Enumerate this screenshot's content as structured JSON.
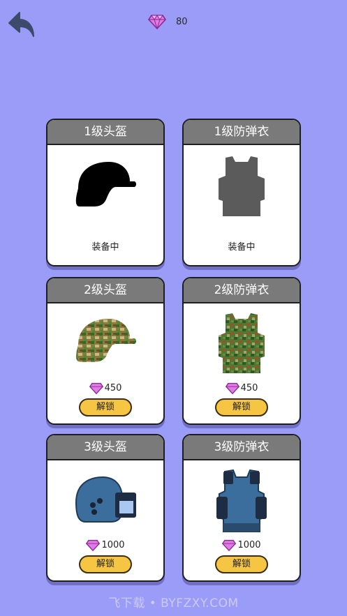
{
  "header": {
    "back_icon": "back-arrow-icon",
    "gem_icon": "diamond-icon",
    "gem_count": "80"
  },
  "cards": [
    {
      "title": "1级头盔",
      "status": "装备中",
      "kind": "helmet-silhouette"
    },
    {
      "title": "1级防弹衣",
      "status": "装备中",
      "kind": "vest-silhouette"
    },
    {
      "title": "2级头盔",
      "price": "450",
      "button": "解锁",
      "kind": "helmet-camo"
    },
    {
      "title": "2级防弹衣",
      "price": "450",
      "button": "解锁",
      "kind": "vest-camo"
    },
    {
      "title": "3级头盔",
      "price": "1000",
      "button": "解锁",
      "kind": "helmet-visor"
    },
    {
      "title": "3级防弹衣",
      "price": "1000",
      "button": "解锁",
      "kind": "vest-tactical"
    }
  ],
  "watermark": "飞下载 • BYFZXY.COM",
  "colors": {
    "background": "#9a9cf8",
    "card_header": "#7a7a7a",
    "unlock_button": "#f6c544",
    "gem": "#d45ad8"
  }
}
